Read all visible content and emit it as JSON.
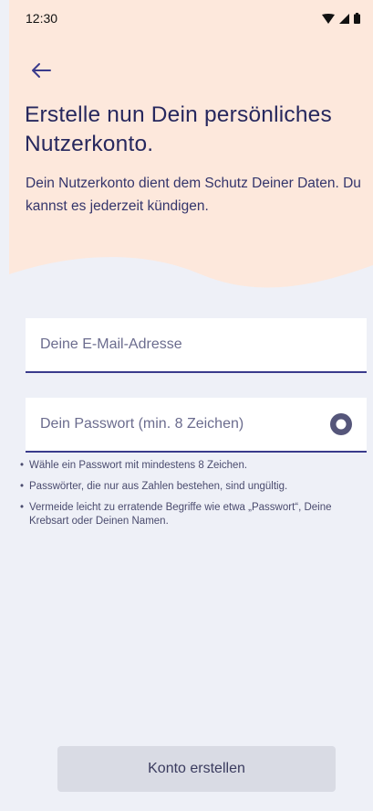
{
  "status_bar": {
    "time": "12:30",
    "icons": [
      "wifi-icon",
      "signal-icon",
      "battery-icon"
    ]
  },
  "header": {
    "back_icon": "arrow-left-icon",
    "title": "Erstelle nun Dein persönliches Nutzerkonto.",
    "subtitle": "Dein Nutzerkonto dient dem Schutz Deiner Daten. Du kannst es jederzeit kündigen."
  },
  "form": {
    "email": {
      "placeholder": "Deine E-Mail-Adresse",
      "value": ""
    },
    "password": {
      "placeholder": "Dein Passwort (min. 8 Zeichen)",
      "value": "",
      "toggle_icon": "eye-icon"
    },
    "hints": [
      "Wähle ein Passwort mit mindestens 8 Zeichen.",
      "Passwörter, die nur aus Zahlen bestehen, sind ungültig.",
      "Vermeide leicht zu erratende Begriffe wie etwa „Passwort“, Deine Krebsart oder Deinen Namen."
    ]
  },
  "actions": {
    "submit_label": "Konto erstellen"
  },
  "colors": {
    "hero_background": "#fde8dc",
    "page_background": "#eef0f7",
    "accent": "#3a3b8c",
    "button_disabled": "#d9dbe4"
  }
}
